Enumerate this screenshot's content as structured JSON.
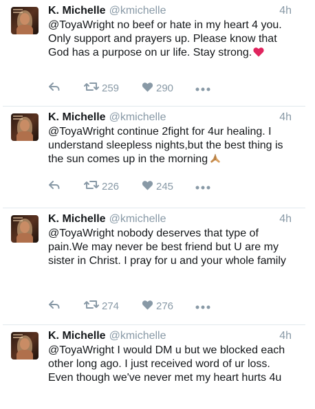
{
  "tweets": [
    {
      "name": "K. Michelle",
      "handle": "@kmichelle",
      "time": "4h",
      "text": "@ToyaWright no beef or hate in my heart 4 you. Only support and prayers up. Please know that God has a purpose on ur life. Stay strong.",
      "emoji": "red-heart",
      "retweets": "259",
      "likes": "290"
    },
    {
      "name": "K. Michelle",
      "handle": "@kmichelle",
      "time": "4h",
      "text": "@ToyaWright continue 2fight for 4ur healing. I understand sleepless nights,but the best thing is the sun comes up in the morning",
      "emoji": "praying-hands",
      "retweets": "226",
      "likes": "245"
    },
    {
      "name": "K. Michelle",
      "handle": "@kmichelle",
      "time": "4h",
      "text": "@ToyaWright nobody deserves that type of pain.We may never be best friend but U are my sister in Christ. I pray for u and your whole family",
      "retweets": "274",
      "likes": "276"
    },
    {
      "name": "K. Michelle",
      "handle": "@kmichelle",
      "time": "4h",
      "text": "@ToyaWright I would DM u but we blocked each other long ago. I just received word of ur loss. Even though we've never met my heart hurts 4u"
    }
  ],
  "icons": {
    "reply": "reply-icon",
    "retweet": "retweet-icon",
    "like": "like-icon",
    "more": "more-icon"
  },
  "colors": {
    "text": "#14171a",
    "muted": "#8899a6",
    "divider": "#e1e8ed",
    "heart_emoji": "#e0245e"
  }
}
